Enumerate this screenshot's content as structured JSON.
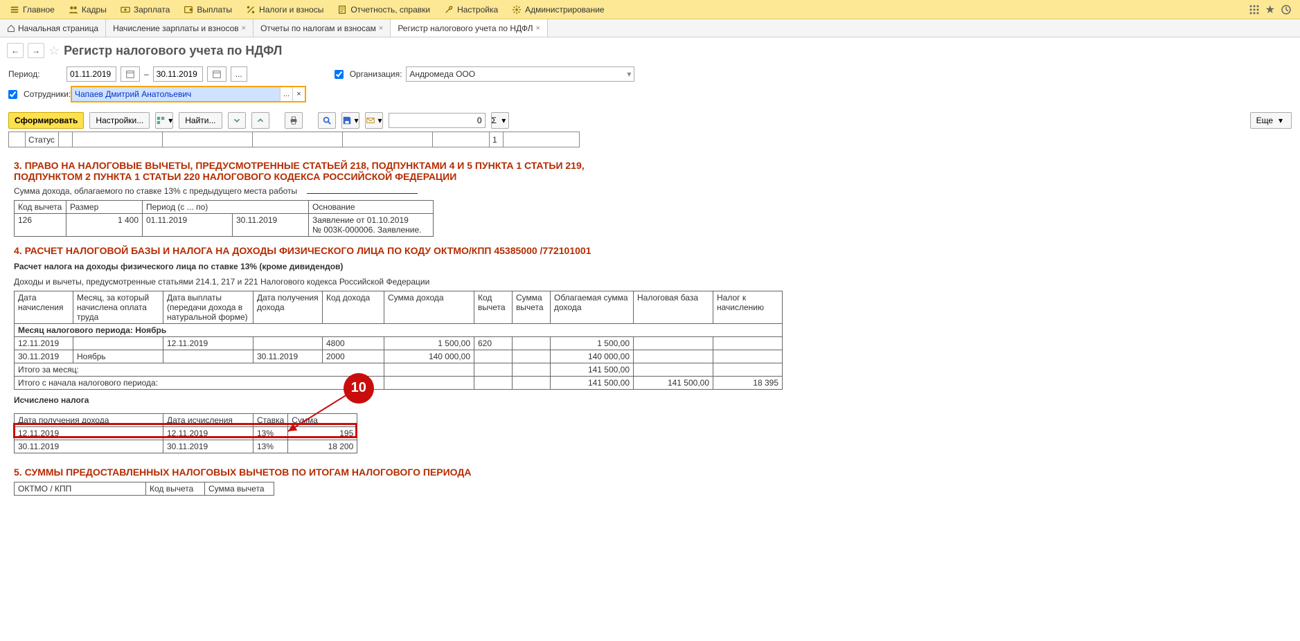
{
  "topmenu": {
    "items": [
      {
        "label": "Главное"
      },
      {
        "label": "Кадры"
      },
      {
        "label": "Зарплата"
      },
      {
        "label": "Выплаты"
      },
      {
        "label": "Налоги и взносы"
      },
      {
        "label": "Отчетность, справки"
      },
      {
        "label": "Настройка"
      },
      {
        "label": "Администрирование"
      }
    ]
  },
  "tabs": [
    {
      "label": "Начальная страница",
      "closable": false,
      "icon": "home"
    },
    {
      "label": "Начисление зарплаты и взносов",
      "closable": true
    },
    {
      "label": "Отчеты по налогам и взносам",
      "closable": true
    },
    {
      "label": "Регистр налогового учета по НДФЛ",
      "closable": true,
      "active": true
    }
  ],
  "title": "Регистр налогового учета по НДФЛ",
  "filters": {
    "period_label": "Период:",
    "date_from": "01.11.2019",
    "dash": "–",
    "date_to": "30.11.2019",
    "dots": "...",
    "org_check": true,
    "org_label": "Организация:",
    "org_value": "Андромеда ООО",
    "emp_check": true,
    "emp_label": "Сотрудники:",
    "emp_value": "Чапаев Дмитрий Анатольевич"
  },
  "toolbar": {
    "generate": "Сформировать",
    "settings": "Настройки...",
    "find": "Найти...",
    "num": "0",
    "more": "Еще"
  },
  "status": {
    "label": "Статус",
    "val": "1"
  },
  "section3": {
    "title": "3. ПРАВО НА НАЛОГОВЫЕ ВЫЧЕТЫ, ПРЕДУСМОТРЕННЫЕ СТАТЬЕЙ  218, ПОДПУНКТАМИ 4 И 5 ПУНКТА 1 СТАТЬИ 219, ПОДПУНКТОМ 2 ПУНКТА 1 СТАТЬИ 220 НАЛОГОВОГО КОДЕКСА РОССИЙСКОЙ ФЕДЕРАЦИИ",
    "prev": "Сумма дохода, облагаемого по ставке 13% с предыдущего места работы",
    "headers": {
      "code": "Код вычета",
      "size": "Размер",
      "period": "Период (с ... по)",
      "basis": "Основание"
    },
    "row": {
      "code": "126",
      "size": "1 400",
      "from": "01.11.2019",
      "to": "30.11.2019",
      "basis1": "Заявление от 01.10.2019",
      "basis2": "№ 003К-000006. Заявление."
    }
  },
  "section4": {
    "title": "4. РАСЧЕТ НАЛОГОВОЙ БАЗЫ И НАЛОГА НА ДОХОДЫ ФИЗИЧЕСКОГО ЛИЦА ПО КОДУ ОКТМО/КПП 45385000   /772101001",
    "sub": "Расчет налога на доходы физического лица по ставке 13% (кроме дивидендов)",
    "note": "Доходы и вычеты, предусмотренные статьями 214.1, 217 и 221 Налогового кодекса Российской Федерации",
    "headers": [
      "Дата начисления",
      "Месяц, за который начислена оплата труда",
      "Дата выплаты (передачи дохода в натуральной форме)",
      "Дата получения дохода",
      "Код дохода",
      "Сумма дохода",
      "Код вычета",
      "Сумма вычета",
      "Облагаемая сумма дохода",
      "Налоговая база",
      "Налог к начислению"
    ],
    "month_label": "Месяц налогового периода: Ноябрь",
    "r1": [
      "12.11.2019",
      "",
      "12.11.2019",
      "",
      "4800",
      "1 500,00",
      "620",
      "",
      "1 500,00",
      "",
      ""
    ],
    "r2": [
      "30.11.2019",
      "Ноябрь",
      "",
      "30.11.2019",
      "2000",
      "140 000,00",
      "",
      "",
      "140 000,00",
      "",
      ""
    ],
    "tot_m": [
      "Итого за месяц:",
      "",
      "",
      "",
      "",
      "",
      "",
      "",
      "141 500,00",
      "",
      ""
    ],
    "tot_p": [
      "Итого с начала налогового периода:",
      "",
      "",
      "",
      "",
      "",
      "",
      "",
      "141 500,00",
      "141 500,00",
      "18 395"
    ],
    "calc_title": "Исчислено налога",
    "calc_headers": [
      "Дата получения дохода",
      "Дата исчисления",
      "Ставка",
      "Сумма"
    ],
    "calc_r1": [
      "12.11.2019",
      "12.11.2019",
      "13%",
      "195"
    ],
    "calc_r2": [
      "30.11.2019",
      "30.11.2019",
      "13%",
      "18 200"
    ]
  },
  "section5": {
    "title": "5. СУММЫ ПРЕДОСТАВЛЕННЫХ НАЛОГОВЫХ ВЫЧЕТОВ ПО ИТОГАМ НАЛОГОВОГО ПЕРИОДА",
    "headers": [
      "ОКТМО / КПП",
      "Код вычета",
      "Сумма вычета"
    ]
  },
  "annotation": {
    "number": "10"
  }
}
